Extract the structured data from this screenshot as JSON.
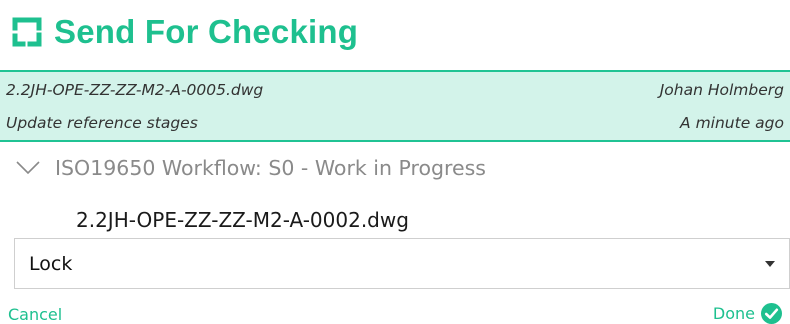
{
  "header": {
    "title": "Send For Checking",
    "logo_icon": "bracket-logo-icon",
    "accent_color": "#1ec08f"
  },
  "info": {
    "file_name": "2.2JH-OPE-ZZ-ZZ-M2-A-0005.dwg",
    "user": "Johan Holmberg",
    "comment": "Update reference stages",
    "time": "A minute ago",
    "background_color": "#d3f3ea"
  },
  "workflow": {
    "icon": "chevron-down-icon",
    "label": "ISO19650 Workflow: S0 - Work in Progress"
  },
  "item": {
    "file_name": "2.2JH-OPE-ZZ-ZZ-M2-A-0002.dwg"
  },
  "action_select": {
    "value": "Lock",
    "icon": "dropdown-arrow-icon"
  },
  "footer": {
    "cancel_label": "Cancel",
    "done_label": "Done",
    "done_icon": "check-circle-icon"
  }
}
